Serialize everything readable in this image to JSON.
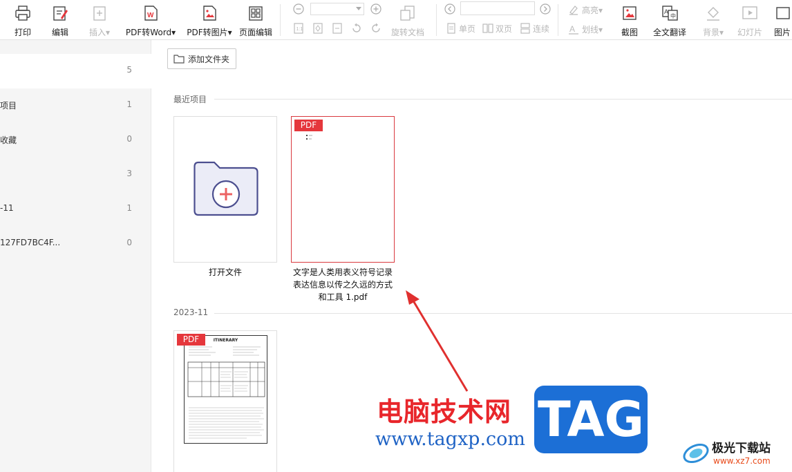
{
  "toolbar": {
    "print": "打印",
    "edit": "编辑",
    "insert": "插入",
    "pdf_to_word": "PDF转Word",
    "pdf_to_image": "PDF转图片",
    "page_edit": "页面编辑",
    "rotate_doc": "旋转文档",
    "single_page": "单页",
    "double_page": "双页",
    "continuous": "连续",
    "highlight": "高亮",
    "strikeline": "划线",
    "screenshot": "截图",
    "full_translate": "全文翻译",
    "background": "背景",
    "slideshow": "幻灯片",
    "image": "图片",
    "zoom_value": "",
    "page_value": ""
  },
  "sidebar": {
    "items": [
      {
        "label": "",
        "count": "5"
      },
      {
        "label": "项目",
        "count": "1"
      },
      {
        "label": "收藏",
        "count": "0"
      },
      {
        "label": "",
        "count": "3"
      },
      {
        "label": "-11",
        "count": "1"
      },
      {
        "label": "127FD7BC4F...",
        "count": "0"
      }
    ]
  },
  "main": {
    "add_folder": "添加文件夹",
    "recent_title": "最近项目",
    "month_title": "2023-11",
    "open_file": "打开文件",
    "recent_file": {
      "tag": "PDF",
      "caption_lines": [
        "文字是人类用表义符号记录",
        "表达信息以传之久远的方式",
        "和工具 1.pdf"
      ]
    },
    "month_file": {
      "tag": "PDF",
      "thumb_title": "ITINERARY"
    }
  },
  "watermark": {
    "cn_text": "电脑技术网",
    "url": "www.tagxp.com",
    "tag": "TAG",
    "site_name": "极光下载站",
    "site_url": "www.xz7.com"
  },
  "colors": {
    "accent_red": "#e5373c",
    "tag_blue": "#1c6fd6",
    "folder_purple": "#4b4e8f"
  }
}
